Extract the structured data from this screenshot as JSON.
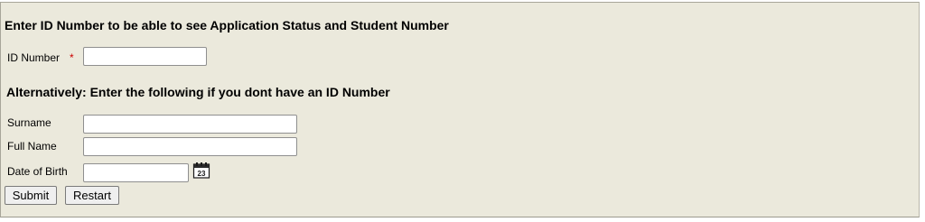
{
  "form": {
    "id_heading": "Enter ID Number to be able to see Application Status and Student Number",
    "id_label": "ID Number",
    "required_mark": "*",
    "id_value": "",
    "alt_heading": "Alternatively: Enter the following if you dont have an ID Number",
    "surname_label": "Surname",
    "surname_value": "",
    "fullname_label": "Full Name",
    "fullname_value": "",
    "dob_label": "Date of Birth",
    "dob_value": "",
    "calendar_icon": "calendar-icon",
    "calendar_day": "23",
    "submit_label": "Submit",
    "restart_label": "Restart"
  },
  "colors": {
    "panel_background": "#ebe9dc",
    "required_color": "#cc0000"
  }
}
